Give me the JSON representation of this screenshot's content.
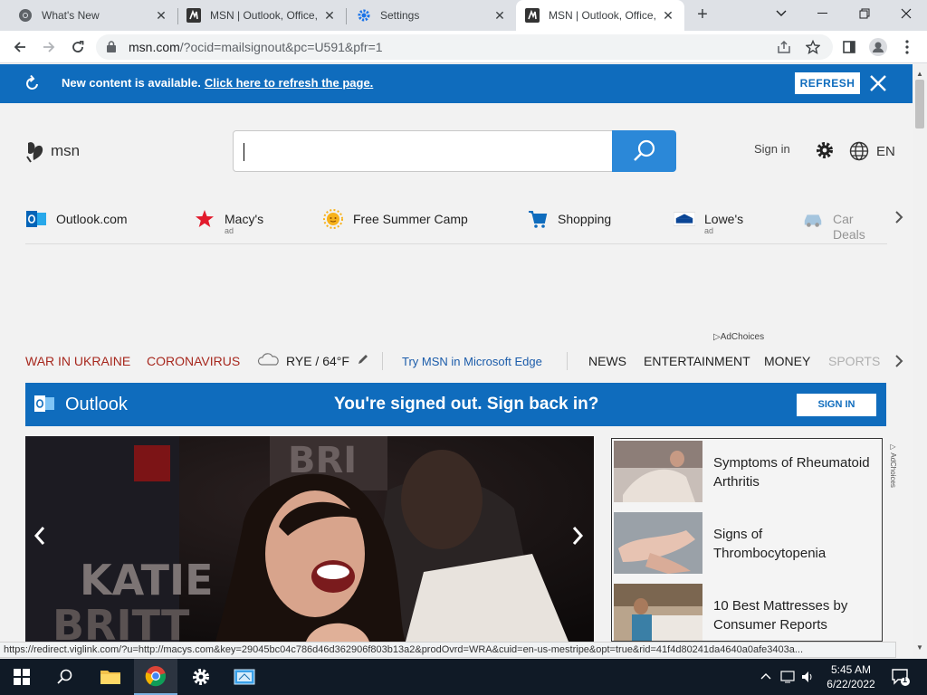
{
  "browser": {
    "tabs": [
      {
        "title": "What's New",
        "icon": "chrome-icon",
        "active": false
      },
      {
        "title": "MSN | Outlook, Office,",
        "icon": "msn-icon",
        "active": false
      },
      {
        "title": "Settings",
        "icon": "gear-icon",
        "active": false
      },
      {
        "title": "MSN | Outlook, Office,",
        "icon": "msn-icon",
        "active": true
      }
    ],
    "new_tab": "+",
    "url_host": "msn.com",
    "url_rest": "/?ocid=mailsignout&pc=U591&pfr=1"
  },
  "banner": {
    "message": "New content is available.",
    "link": "Click here to refresh the page.",
    "button": "REFRESH"
  },
  "header": {
    "logo_text": "msn",
    "search_value": "",
    "signin": "Sign in",
    "language": "EN"
  },
  "quicklinks": [
    {
      "label": "Outlook.com",
      "ad": "",
      "icon": "outlook-icon"
    },
    {
      "label": "Macy's",
      "ad": "ad",
      "icon": "macys-star-icon"
    },
    {
      "label": "Free Summer Camp",
      "ad": "",
      "icon": "sun-icon"
    },
    {
      "label": "Shopping",
      "ad": "",
      "icon": "cart-icon"
    },
    {
      "label": "Lowe's",
      "ad": "ad",
      "icon": "lowes-icon"
    },
    {
      "label": "Car Deals",
      "ad": "",
      "icon": "car-icon"
    }
  ],
  "adchoices": "AdChoices",
  "nav": {
    "ukraine": "WAR IN UKRAINE",
    "corona": "CORONAVIRUS",
    "weather": "RYE / 64°F",
    "edge": "Try MSN in Microsoft Edge",
    "news": "NEWS",
    "entertainment": "ENTERTAINMENT",
    "money": "MONEY",
    "sports": "SPORTS"
  },
  "outlook_bar": {
    "name": "Outlook",
    "message": "You're signed out. Sign back in?",
    "button": "SIGN IN"
  },
  "hero": {
    "sign_text_1": "KATIE",
    "sign_text_2": "BRITT",
    "sign_text_top": "BRI"
  },
  "rail": [
    {
      "title": "Symptoms of Rheumatoid Arthritis"
    },
    {
      "title": "Signs of Thrombocytopenia"
    },
    {
      "title": "10 Best Mattresses by Consumer Reports"
    }
  ],
  "rail_adchoices": "AdChoices",
  "status_url": "https://redirect.viglink.com/?u=http://macys.com&key=29045bc04c786d46d362906f803b13a2&prodOvrd=WRA&cuid=en-us-mestripe&opt=true&rid=41f4d80241da4640a0afe3403a...",
  "taskbar": {
    "time": "5:45 AM",
    "date": "6/22/2022",
    "notifications": "1"
  },
  "colors": {
    "msn_blue": "#0f6cbd",
    "search_blue": "#2b88d8",
    "nav_red": "#a7281e"
  }
}
